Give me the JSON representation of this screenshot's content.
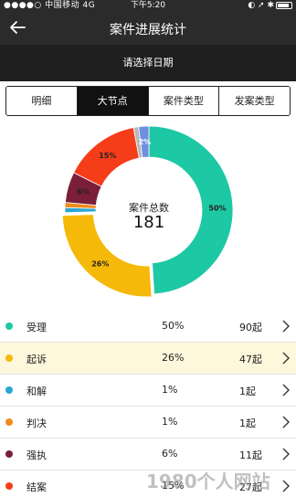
{
  "status_bar": {
    "left": "●●●●○ 中国移动  4G",
    "time": "下午5:20",
    "right": "◐ ➚ ✱"
  },
  "nav": {
    "title": "案件进展统计",
    "back_icon": "arrow-left-icon"
  },
  "date_picker": {
    "label": "请选择日期"
  },
  "tabs": [
    {
      "label": "明细",
      "active": false
    },
    {
      "label": "大节点",
      "active": true
    },
    {
      "label": "案件类型",
      "active": false
    },
    {
      "label": "发案类型",
      "active": false
    }
  ],
  "chart_data": {
    "type": "pie",
    "style": "donut",
    "center_label": "案件总数",
    "center_value": "181",
    "slices": [
      {
        "label": "受理",
        "value": 50,
        "display": "50%",
        "color": "#1dc8a4"
      },
      {
        "label": "起诉",
        "value": 26,
        "display": "26%",
        "color": "#f5b90a"
      },
      {
        "label": "和解",
        "value": 1,
        "display": "1%",
        "color": "#2aa6d4"
      },
      {
        "label": "判决",
        "value": 1,
        "display": "1%",
        "color": "#f08a1c"
      },
      {
        "label": "强执",
        "value": 6,
        "display": "6%",
        "color": "#7a1e3a"
      },
      {
        "label": "结案",
        "value": 15,
        "display": "15%",
        "color": "#f53d1a"
      },
      {
        "label": "",
        "value": 1,
        "display": "1%",
        "color": "#b8b8b8"
      },
      {
        "label": "",
        "value": 2,
        "display": "2%",
        "color": "#6f8fe0"
      }
    ]
  },
  "list": [
    {
      "name": "受理",
      "pct": "50%",
      "count": "90起",
      "color": "#1dc8a4",
      "highlight": false
    },
    {
      "name": "起诉",
      "pct": "26%",
      "count": "47起",
      "color": "#f5b90a",
      "highlight": true
    },
    {
      "name": "和解",
      "pct": "1%",
      "count": "1起",
      "color": "#2aa6d4",
      "highlight": false
    },
    {
      "name": "判决",
      "pct": "1%",
      "count": "1起",
      "color": "#f08a1c",
      "highlight": false
    },
    {
      "name": "强执",
      "pct": "6%",
      "count": "11起",
      "color": "#7a1e3a",
      "highlight": false
    },
    {
      "name": "结案",
      "pct": "15%",
      "count": "27起",
      "color": "#f53d1a",
      "highlight": false
    }
  ],
  "watermark": "1980个人网站"
}
